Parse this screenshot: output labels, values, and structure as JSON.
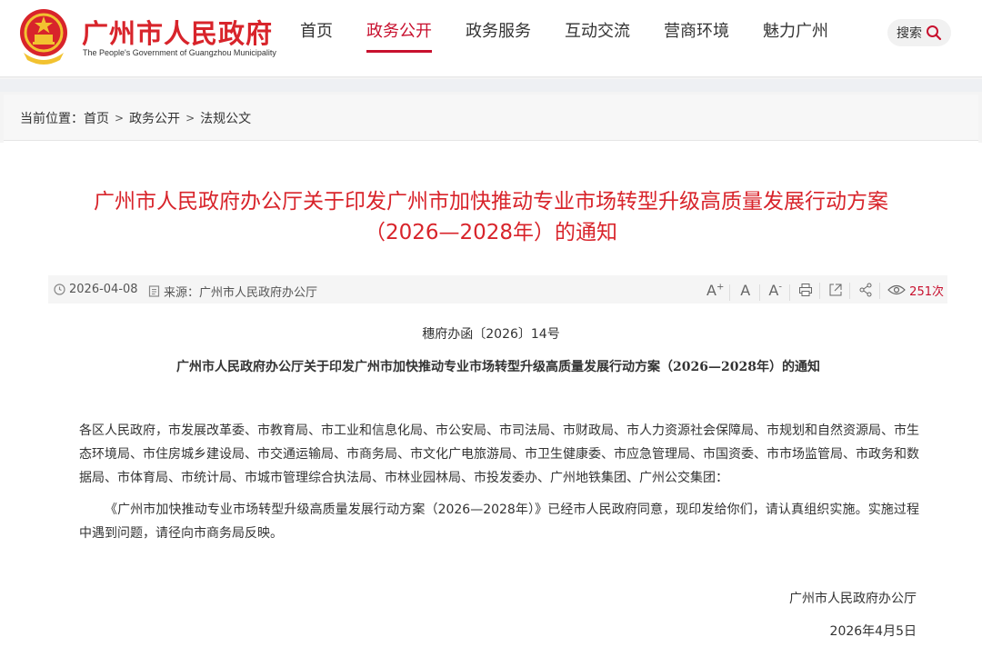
{
  "header": {
    "site_title": "广州市人民政府",
    "site_subtitle": "The People's Government of Guangzhou Municipality",
    "nav": [
      "首页",
      "政务公开",
      "政务服务",
      "互动交流",
      "营商环境",
      "魅力广州"
    ],
    "active_nav": "政务公开",
    "search_label": "搜索"
  },
  "breadcrumb": {
    "prefix": "当前位置：",
    "items": [
      "首页",
      "政务公开",
      "法规公文"
    ],
    "separator": ">"
  },
  "article": {
    "title_line1": "广州市人民政府办公厅关于印发广州市加快推动专业市场转型升级高质量发展行动方案",
    "title_line2": "（2026—2028年）的通知",
    "date": "2026-04-08",
    "source": "来源：广州市人民政府办公厅",
    "views": "251次",
    "tools": [
      "A+",
      "A",
      "A-",
      "print-icon",
      "share-doc-icon",
      "share-icon"
    ],
    "doc_number": "穗府办函〔2026〕14号",
    "doc_title": "广州市人民政府办公厅关于印发广州市加快推动专业市场转型升级高质量发展行动方案（2026—2028年）的通知",
    "paragraph1": "各区人民政府，市发展改革委、市教育局、市工业和信息化局、市公安局、市司法局、市财政局、市人力资源社会保障局、市规划和自然资源局、市生态环境局、市住房城乡建设局、市交通运输局、市商务局、市文化广电旅游局、市卫生健康委、市应急管理局、市国资委、市市场监管局、市政务和数据局、市体育局、市统计局、市城市管理综合执法局、市林业园林局、市投发委办、广州地铁集团、广州公交集团：",
    "paragraph2": "《广州市加快推动专业市场转型升级高质量发展行动方案（2026—2028年）》已经市人民政府同意，现印发给你们，请认真组织实施。实施过程中遇到问题，请径向市商务局反映。",
    "signature": "广州市人民政府办公厅",
    "sign_date": "2026年4月5日"
  },
  "colors": {
    "accent": "#d8242b",
    "nav_active": "#c8102e"
  }
}
